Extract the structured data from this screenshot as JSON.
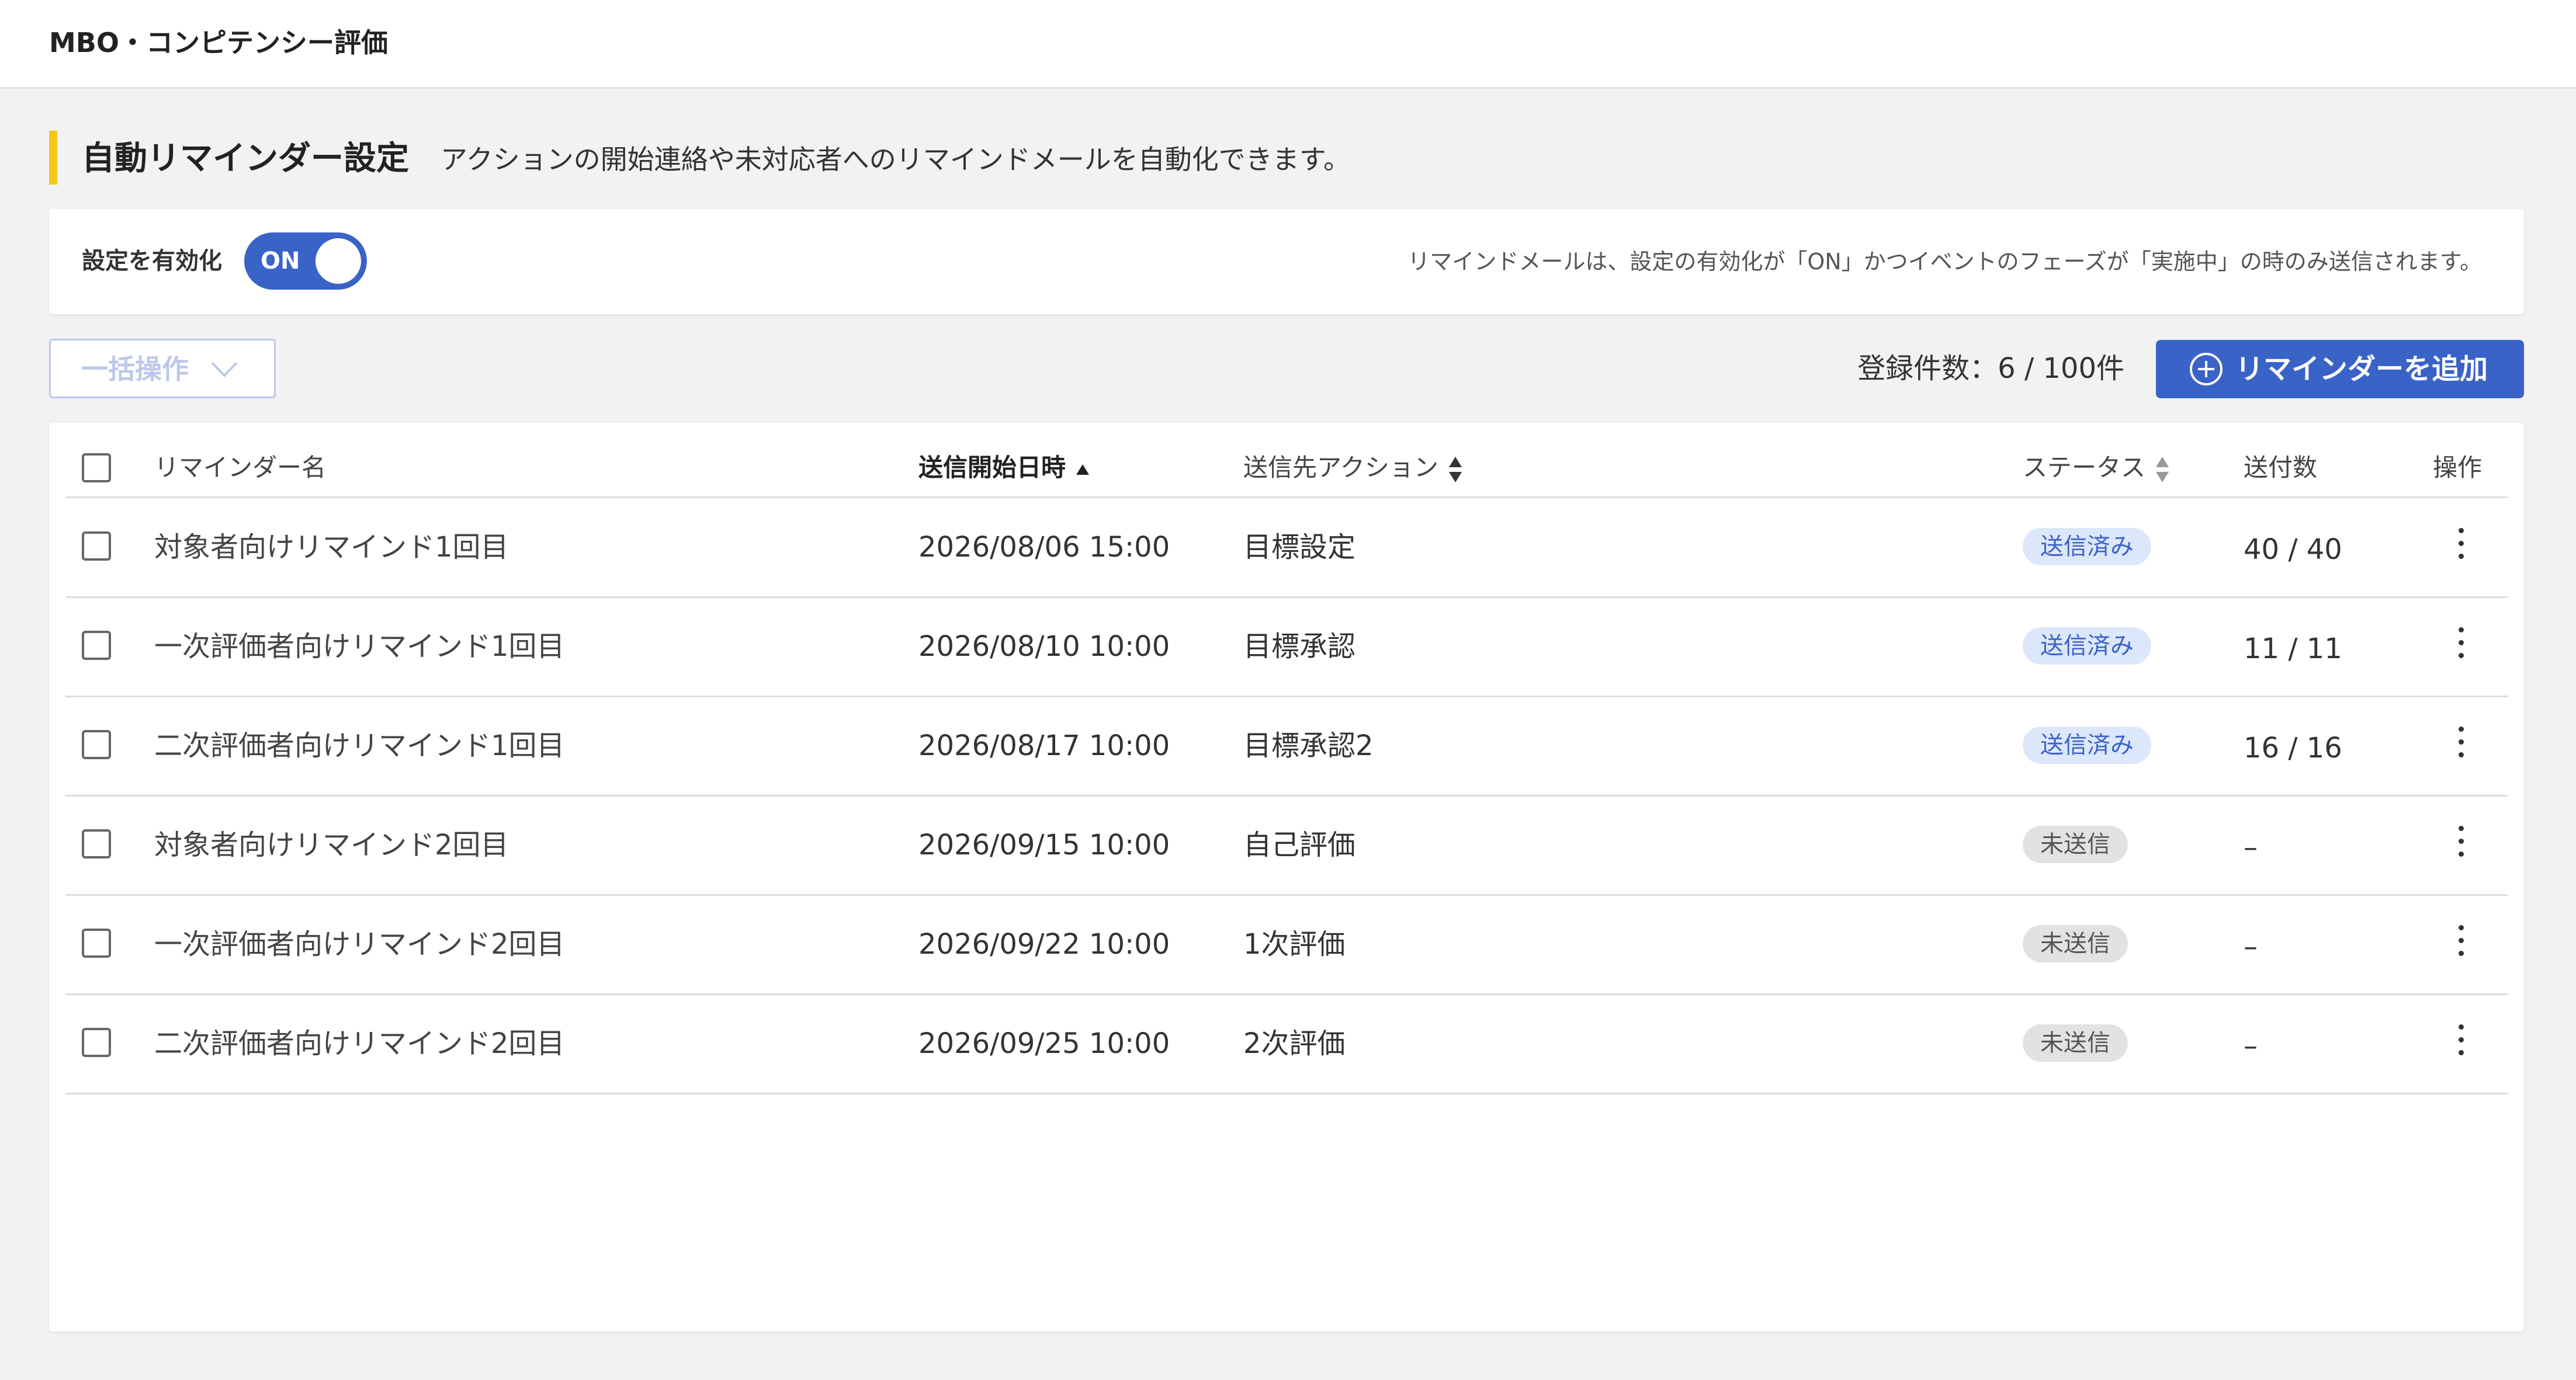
{
  "header": {
    "title": "MBO・コンピテンシー評価"
  },
  "section": {
    "title": "自動リマインダー設定",
    "description": "アクションの開始連絡や未対応者へのリマインドメールを自動化できます。"
  },
  "settings": {
    "enable_label": "設定を有効化",
    "toggle_state": "ON",
    "note": "リマインドメールは、設定の有効化が「ON」かつイベントのフェーズが「実施中」の時のみ送信されます。"
  },
  "toolbar": {
    "bulk_label": "一括操作",
    "count_text": "登録件数：6 / 100件",
    "add_label": "リマインダーを追加"
  },
  "colors": {
    "accent": "#f5c518",
    "primary": "#3a63c8",
    "sent_badge_bg": "#dde7fb",
    "unsent_badge_bg": "#e2e2e4"
  },
  "table": {
    "columns": {
      "name": "リマインダー名",
      "datetime": "送信開始日時",
      "action": "送信先アクション",
      "status": "ステータス",
      "sent_count": "送付数",
      "operation": "操作"
    },
    "rows": [
      {
        "name": "対象者向けリマインド1回目",
        "datetime": "2026/08/06 15:00",
        "action": "目標設定",
        "status": "送信済み",
        "status_type": "sent",
        "sent_count": "40 / 40"
      },
      {
        "name": "一次評価者向けリマインド1回目",
        "datetime": "2026/08/10 10:00",
        "action": "目標承認",
        "status": "送信済み",
        "status_type": "sent",
        "sent_count": "11 / 11"
      },
      {
        "name": "二次評価者向けリマインド1回目",
        "datetime": "2026/08/17 10:00",
        "action": "目標承認2",
        "status": "送信済み",
        "status_type": "sent",
        "sent_count": "16 / 16"
      },
      {
        "name": "対象者向けリマインド2回目",
        "datetime": "2026/09/15 10:00",
        "action": "自己評価",
        "status": "未送信",
        "status_type": "unsent",
        "sent_count": "–"
      },
      {
        "name": "一次評価者向けリマインド2回目",
        "datetime": "2026/09/22 10:00",
        "action": "1次評価",
        "status": "未送信",
        "status_type": "unsent",
        "sent_count": "–"
      },
      {
        "name": "二次評価者向けリマインド2回目",
        "datetime": "2026/09/25 10:00",
        "action": "2次評価",
        "status": "未送信",
        "status_type": "unsent",
        "sent_count": "–"
      }
    ]
  }
}
